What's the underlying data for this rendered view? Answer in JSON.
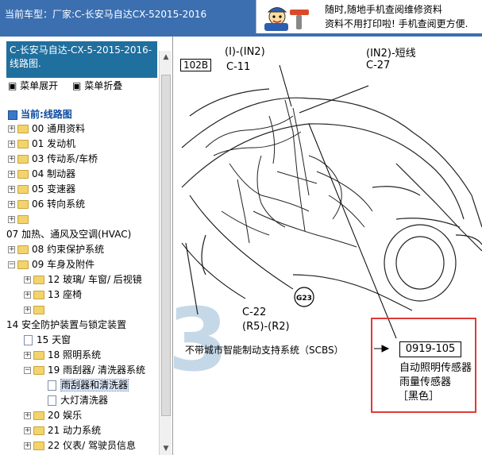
{
  "header": {
    "vehicle_label": "当前车型：厂家:C-长安马自达CX-52015-2016"
  },
  "ad": {
    "line1": "随时,随地手机查阅维修资料",
    "line2": "资料不用打印啦! 手机查阅更方便."
  },
  "sidebar": {
    "doc_title": "C-长安马自达-CX-5-2015-2016- 线路图.",
    "expand_label": "菜单展开",
    "collapse_label": "菜单折叠",
    "current_label": "当前:线路图",
    "items": [
      {
        "label": "00 通用资料"
      },
      {
        "label": "01 发动机"
      },
      {
        "label": "03 传动系/车桥"
      },
      {
        "label": "04 制动器"
      },
      {
        "label": "05 变速器"
      },
      {
        "label": "06 转向系统"
      },
      {
        "label": ""
      },
      {
        "label": "07 加热、通风及空调(HVAC)"
      },
      {
        "label": "08 约束保护系统"
      },
      {
        "label": "09 车身及附件"
      },
      {
        "label": "12 玻璃/ 车窗/ 后视镜"
      },
      {
        "label": "13 座椅"
      },
      {
        "label": ""
      },
      {
        "label": "14 安全防护装置与锁定装置"
      },
      {
        "label": "15 天窗"
      },
      {
        "label": "18 照明系统"
      },
      {
        "label": "19 雨刮器/ 清洗器系统"
      },
      {
        "label": "雨刮器和清洗器"
      },
      {
        "label": "大灯清洗器"
      },
      {
        "label": "20 娱乐"
      },
      {
        "label": "21 动力系统"
      },
      {
        "label": "22 仪表/ 驾驶员信息"
      }
    ]
  },
  "diagram": {
    "ref_box": "102B",
    "label_in2_top": "(I)-(IN2)",
    "label_c11": "C-11",
    "label_in2_short": "(IN2)-短线",
    "label_c27": "C-27",
    "label_g23": "G23",
    "label_c22": "C-22",
    "label_r5r2": "(R5)-(R2)",
    "label_scbs": "不带城市智能制动支持系统（SCBS）",
    "part_no": "0919-105",
    "sensor1": "自动照明传感器",
    "sensor2": "雨量传感器",
    "sensor3": "［黑色］",
    "watermark": "3",
    "colors": {
      "callout": "#e03a3a",
      "watermark": "#c5d8e8"
    }
  }
}
